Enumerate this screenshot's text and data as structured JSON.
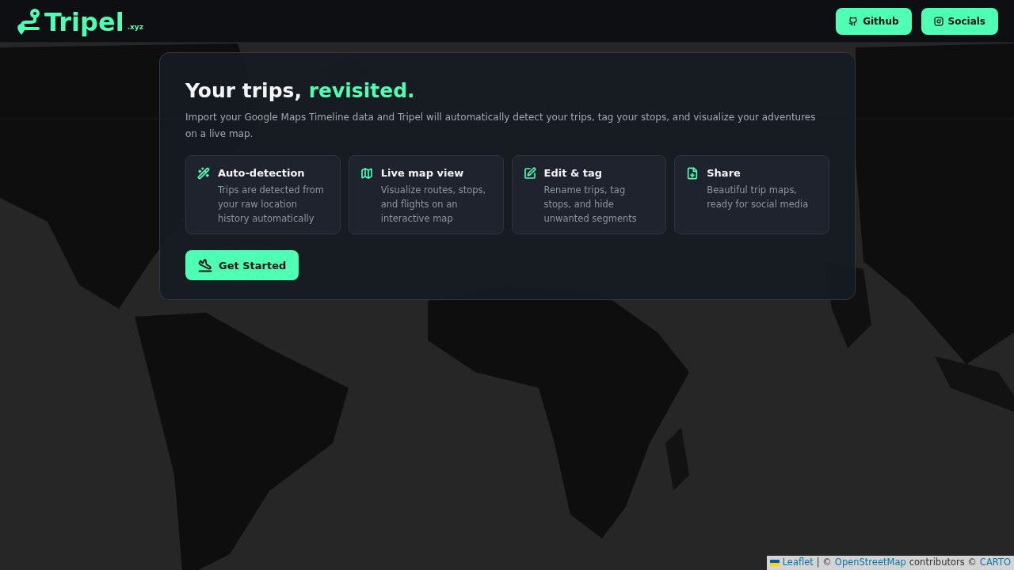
{
  "header": {
    "logo": {
      "name": "Tripel",
      "suffix": ".xyz"
    },
    "buttons": [
      {
        "kind": "github",
        "label": "Github"
      },
      {
        "kind": "socials",
        "label": "Socials"
      }
    ]
  },
  "hero": {
    "title": "Your trips,",
    "highlight": "revisited.",
    "description": "Import your Google Maps Timeline data and Tripel will automatically detect your trips, tag your stops, and visualize your adventures on a live map.",
    "features": [
      {
        "kind": "wand",
        "title": "Auto-detection",
        "text": "Trips are detected from your raw location history automatically"
      },
      {
        "kind": "map",
        "title": "Live map view",
        "text": "Visualize routes, stops, and flights on an interactive map"
      },
      {
        "kind": "edit",
        "title": "Edit & tag",
        "text": "Rename trips, tag stops, and hide unwanted segments"
      },
      {
        "kind": "share",
        "title": "Share",
        "text": "Beautiful trip maps, ready for social media"
      }
    ],
    "cta": "Get Started"
  },
  "attribution": [
    {
      "kind": "link",
      "text": "Leaflet",
      "flag": true
    },
    {
      "kind": "text",
      "text": "| ©"
    },
    {
      "kind": "link",
      "text": "OpenStreetMap"
    },
    {
      "kind": "text",
      "text": "contributors ©"
    },
    {
      "kind": "link",
      "text": "CARTO"
    }
  ]
}
